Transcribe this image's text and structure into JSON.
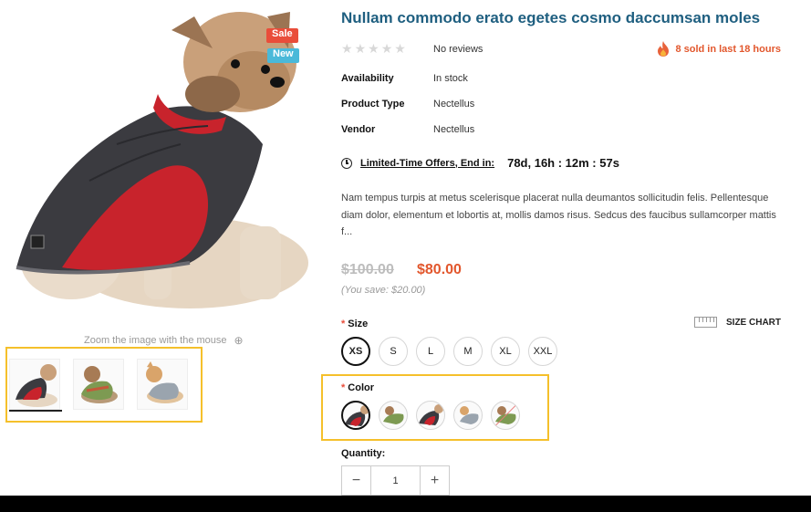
{
  "product": {
    "title": "Nullam commodo erato egetes cosmo daccumsan moles",
    "badges": {
      "sale": "Sale",
      "new": "New"
    },
    "rating": {
      "stars": 0,
      "max": 5,
      "reviews_text": "No reviews"
    },
    "sold_text": "8 sold in last 18 hours",
    "meta": [
      {
        "label": "Availability",
        "value": "In stock"
      },
      {
        "label": "Product Type",
        "value": "Nectellus"
      },
      {
        "label": "Vendor",
        "value": "Nectellus"
      }
    ],
    "countdown": {
      "label": "Limited-Time Offers, End in:",
      "time": "78d, 16h : 12m : 57s"
    },
    "description": "Nam tempus turpis at metus scelerisque placerat nulla deumantos sollicitudin felis. Pellentesque diam dolor, elementum et lobortis at, mollis damos risus. Sedcus des faucibus sullamcorper mattis f...",
    "price": {
      "old": "$100.00",
      "new": "$80.00",
      "you_save": "(You save: $20.00)"
    }
  },
  "gallery": {
    "zoom_hint": "Zoom the image with the mouse",
    "thumbnails": [
      "red-coat",
      "green-sweater",
      "grey-sweater"
    ],
    "active_thumb": 0
  },
  "options": {
    "size": {
      "label": "Size",
      "required_mark": "*",
      "size_chart": "SIZE CHART",
      "values": [
        "XS",
        "S",
        "L",
        "M",
        "XL",
        "XXL"
      ],
      "selected": "XS"
    },
    "color": {
      "label": "Color",
      "required_mark": "*",
      "swatches": [
        "red-coat",
        "green-sweater",
        "red-coat",
        "grey-sweater",
        "green-sweater"
      ],
      "selected_index": 0,
      "unavailable_index": 4
    }
  },
  "quantity": {
    "label": "Quantity:",
    "value": "1",
    "minus": "−",
    "plus": "+"
  },
  "colors": {
    "title": "#1f5f80",
    "sale": "#e94d3a",
    "new": "#4ab9d9",
    "price_new": "#e2572d",
    "highlight": "#f5c02b"
  },
  "icons": [
    "star-icon",
    "fire-icon",
    "clock-icon",
    "zoom-icon",
    "ruler-icon",
    "minus-icon",
    "plus-icon"
  ]
}
